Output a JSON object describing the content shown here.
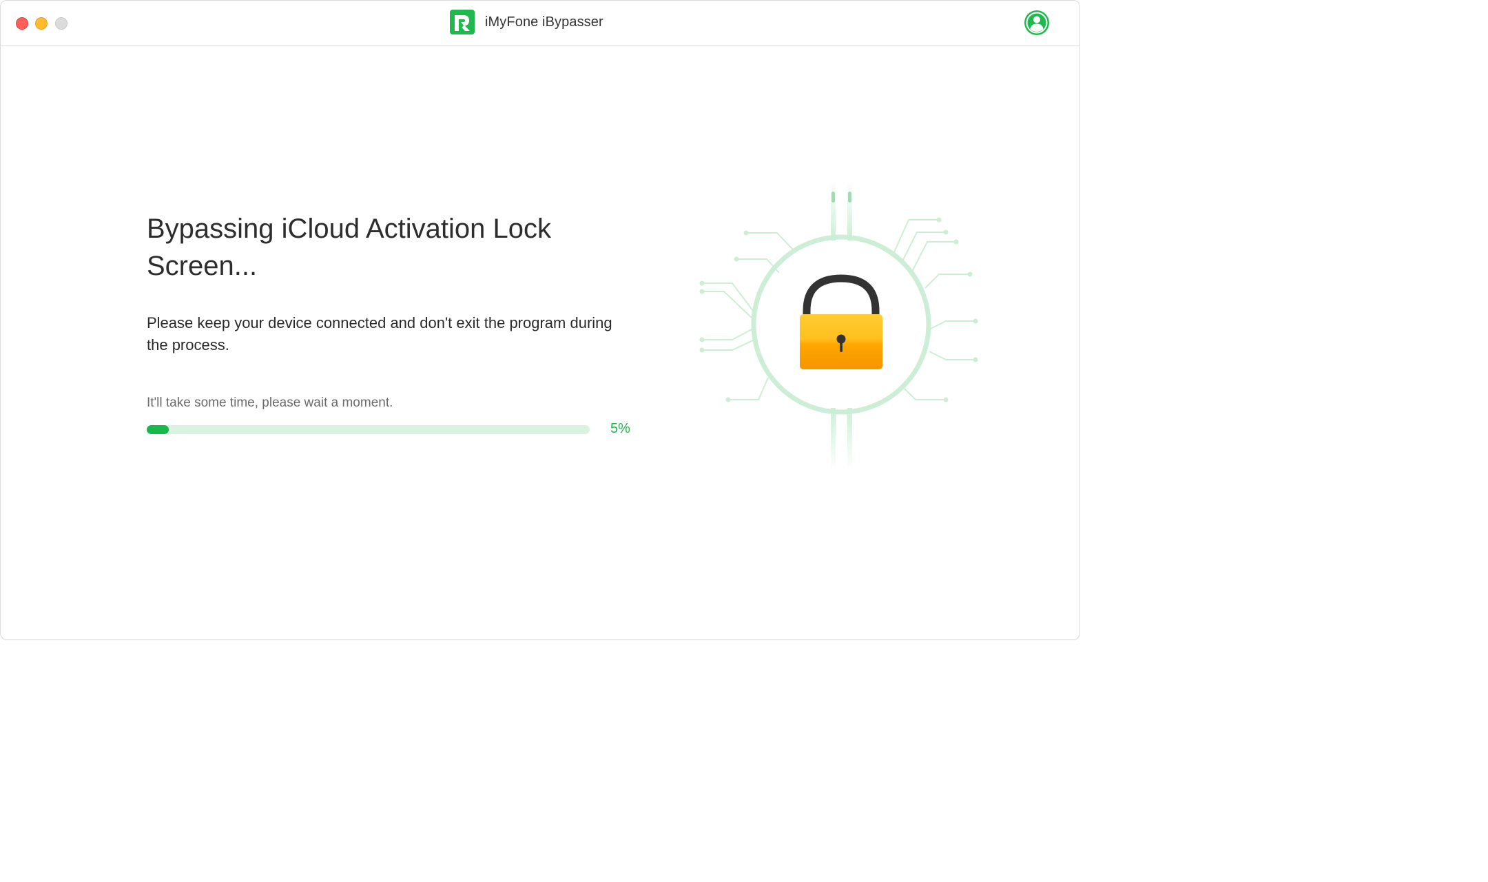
{
  "window": {
    "title": "iMyFone iBypasser",
    "controls": [
      "close",
      "minimize",
      "maximize"
    ]
  },
  "header": {
    "app_name": "iMyFone iBypasser",
    "logo_icon": "imyfone-logo-icon",
    "account_icon": "user-account-icon"
  },
  "main": {
    "title": "Bypassing iCloud Activation Lock Screen...",
    "description": "Please keep your device connected and don't exit the program during the process.",
    "hint": "It'll take some time, please wait a moment.",
    "progress": {
      "percent": 5,
      "label": "5%"
    },
    "illustration_icon": "padlock-icon"
  },
  "colors": {
    "accent": "#19b84b",
    "progress_track": "#d9f3e0",
    "circuit": "#cdeed6",
    "lock_body": "#f7a300",
    "lock_shackle": "#333333"
  }
}
